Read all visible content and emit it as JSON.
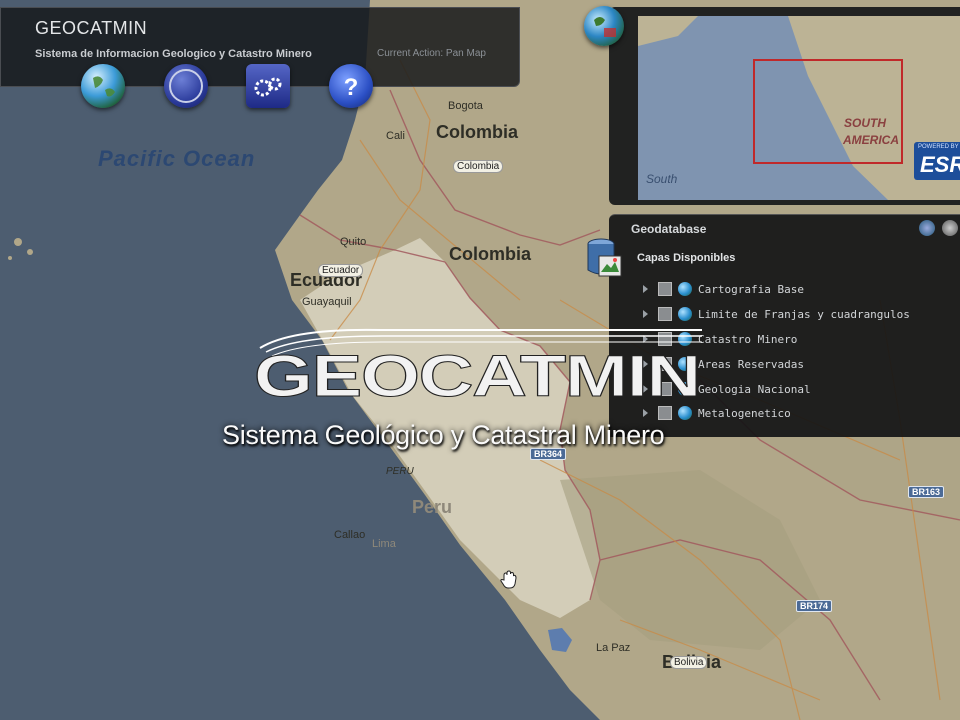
{
  "toolbar": {
    "title": "GEOCATMIN",
    "subtitle": "Sistema de Informacion Geologico y Catastro Minero",
    "current_action": "Current Action: Pan Map",
    "buttons": [
      {
        "icon": "globe-icon"
      },
      {
        "icon": "compass-icon"
      },
      {
        "icon": "gears-icon"
      },
      {
        "icon": "help-icon"
      }
    ]
  },
  "map": {
    "ocean": "Pacific Ocean",
    "countries": [
      "Colombia",
      "Colombia",
      "Ecuador",
      "Peru",
      "Bolivia"
    ],
    "tags": [
      "Colombia",
      "Ecuador",
      "PERU",
      "Bolivia"
    ],
    "cities": [
      "Bogota",
      "Cali",
      "Quito",
      "Guayaquil",
      "Callao",
      "Lima",
      "La Paz"
    ],
    "shields": [
      "BR364",
      "BR163",
      "BR174"
    ]
  },
  "overview": {
    "region_label_1": "SOUTH",
    "region_label_2": "AMERICA",
    "south": "South",
    "esri_top": "POWERED BY",
    "esri": "ESRI"
  },
  "layers": {
    "title": "Geodatabase",
    "header": "Capas Disponibles",
    "items": [
      {
        "label": "Cartografia Base"
      },
      {
        "label": "Limite de Franjas y cuadrangulos"
      },
      {
        "label": "Catastro Minero"
      },
      {
        "label": "Areas Reservadas"
      },
      {
        "label": "Geologia Nacional"
      },
      {
        "label": "Metalogenetico"
      }
    ]
  },
  "splash": {
    "logo": "GEOCATMIN",
    "subtitle": "Sistema Geológico y Catastral Minero"
  },
  "colors": {
    "ocean": "#4d5d70",
    "land": "#b4a98c",
    "peru": "#d5cfba",
    "panel": "#16181a"
  }
}
